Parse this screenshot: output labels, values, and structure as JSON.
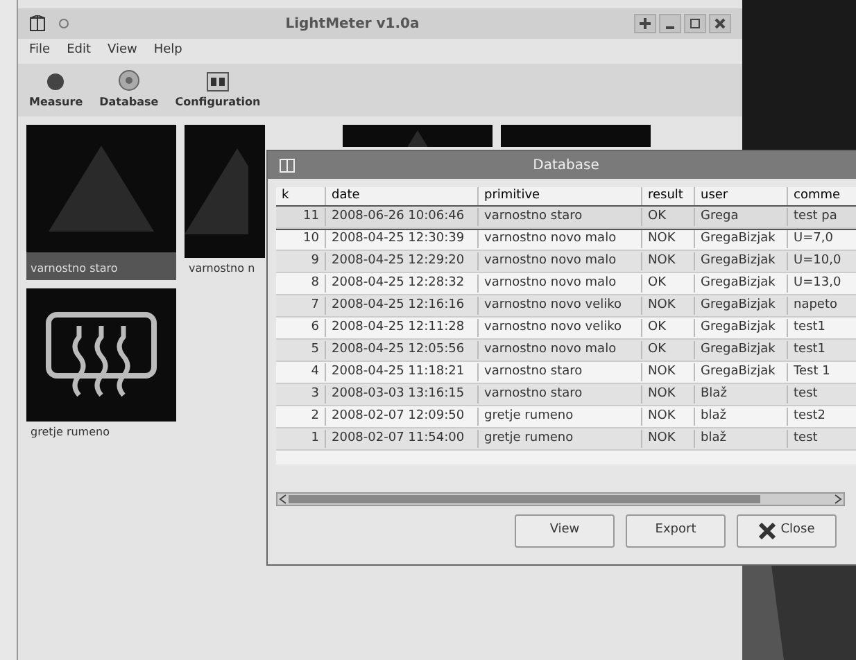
{
  "window": {
    "title": "LightMeter v1.0a"
  },
  "menu": [
    "File",
    "Edit",
    "View",
    "Help"
  ],
  "toolbar": [
    {
      "label": "Measure",
      "kind": "measure"
    },
    {
      "label": "Database",
      "kind": "database"
    },
    {
      "label": "Configuration",
      "kind": "configuration"
    }
  ],
  "tiles": [
    {
      "label": "varnostno staro",
      "kind": "warning",
      "selected": true
    },
    {
      "label": "varnostno n",
      "kind": "warning-cut",
      "selected": false
    },
    {
      "kind": "warning-top",
      "selected": false
    },
    {
      "kind": "blank-top",
      "selected": false
    },
    {
      "label": "gretje rumeno",
      "kind": "heater",
      "selected": false
    }
  ],
  "dialog": {
    "title": "Database",
    "columns": [
      "k",
      "date",
      "primitive",
      "result",
      "user",
      "comme"
    ],
    "rows": [
      {
        "cells": [
          "11",
          "2008-06-26 10:06:46",
          "varnostno staro",
          "OK",
          "Grega",
          "test pa"
        ],
        "selected": true
      },
      {
        "cells": [
          "10",
          "2008-04-25 12:30:39",
          "varnostno novo malo",
          "NOK",
          "GregaBizjak",
          "U=7,0"
        ],
        "selected": false
      },
      {
        "cells": [
          "9",
          "2008-04-25 12:29:20",
          "varnostno novo malo",
          "NOK",
          "GregaBizjak",
          "U=10,0"
        ],
        "selected": false
      },
      {
        "cells": [
          "8",
          "2008-04-25 12:28:32",
          "varnostno novo malo",
          "OK",
          "GregaBizjak",
          "U=13,0"
        ],
        "selected": false
      },
      {
        "cells": [
          "7",
          "2008-04-25 12:16:16",
          "varnostno novo veliko",
          "NOK",
          "GregaBizjak",
          "napeto"
        ],
        "selected": false
      },
      {
        "cells": [
          "6",
          "2008-04-25 12:11:28",
          "varnostno novo veliko",
          "OK",
          "GregaBizjak",
          "test1"
        ],
        "selected": false
      },
      {
        "cells": [
          "5",
          "2008-04-25 12:05:56",
          "varnostno novo malo",
          "OK",
          "GregaBizjak",
          "test1"
        ],
        "selected": false
      },
      {
        "cells": [
          "4",
          "2008-04-25 11:18:21",
          "varnostno staro",
          "NOK",
          "GregaBizjak",
          "Test 1"
        ],
        "selected": false
      },
      {
        "cells": [
          "3",
          "2008-03-03 13:16:15",
          "varnostno staro",
          "NOK",
          "Blaž",
          "test"
        ],
        "selected": false
      },
      {
        "cells": [
          "2",
          "2008-02-07 12:09:50",
          "gretje rumeno",
          "NOK",
          "blaž",
          "test2"
        ],
        "selected": false
      },
      {
        "cells": [
          "1",
          "2008-02-07 11:54:00",
          "gretje rumeno",
          "NOK",
          "blaž",
          "test"
        ],
        "selected": false
      }
    ],
    "buttons": [
      {
        "label": "View",
        "kind": "plain"
      },
      {
        "label": "Export",
        "kind": "plain"
      },
      {
        "label": "Close",
        "kind": "close"
      }
    ]
  }
}
